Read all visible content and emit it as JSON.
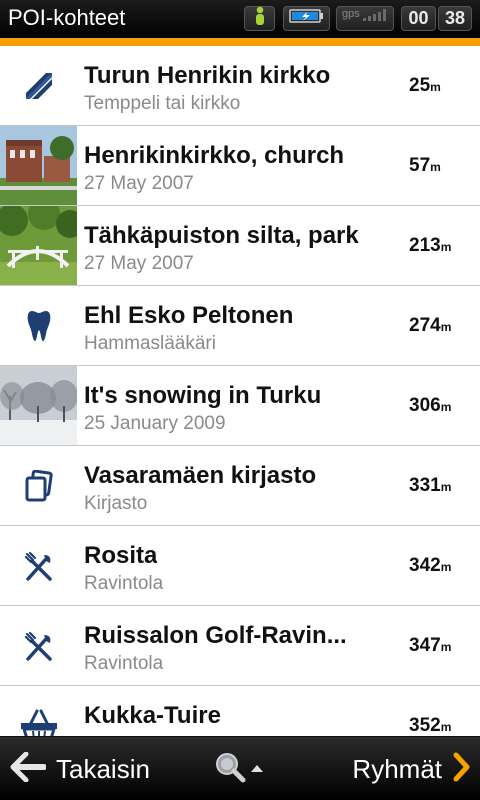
{
  "header": {
    "title": "POI-kohteet",
    "gps_label": "gps",
    "clock_hours": "00",
    "clock_minutes": "38"
  },
  "accent_color": "#f6a100",
  "items": [
    {
      "name": "Turun Henrikin kirkko",
      "sub": "Temppeli tai kirkko",
      "distance": "25",
      "unit": "m",
      "icon": "church-arrow-icon"
    },
    {
      "name": "Henrikinkirkko, church",
      "sub": "27 May 2007",
      "distance": "57",
      "unit": "m",
      "icon": "church-photo"
    },
    {
      "name": "Tähkäpuiston silta, park",
      "sub": "27 May 2007",
      "distance": "213",
      "unit": "m",
      "icon": "park-photo"
    },
    {
      "name": "Ehl Esko Peltonen",
      "sub": "Hammaslääkäri",
      "distance": "274",
      "unit": "m",
      "icon": "tooth-icon"
    },
    {
      "name": "It's snowing in Turku",
      "sub": "25 January 2009",
      "distance": "306",
      "unit": "m",
      "icon": "snow-photo"
    },
    {
      "name": "Vasaramäen kirjasto",
      "sub": "Kirjasto",
      "distance": "331",
      "unit": "m",
      "icon": "library-icon"
    },
    {
      "name": "Rosita",
      "sub": "Ravintola",
      "distance": "342",
      "unit": "m",
      "icon": "restaurant-icon"
    },
    {
      "name": "Ruissalon Golf-Ravin...",
      "sub": "Ravintola",
      "distance": "347",
      "unit": "m",
      "icon": "restaurant-icon"
    },
    {
      "name": "Kukka-Tuire",
      "sub": "",
      "distance": "352",
      "unit": "m",
      "icon": "basket-icon"
    }
  ],
  "bottom": {
    "back_label": "Takaisin",
    "groups_label": "Ryhmät"
  }
}
